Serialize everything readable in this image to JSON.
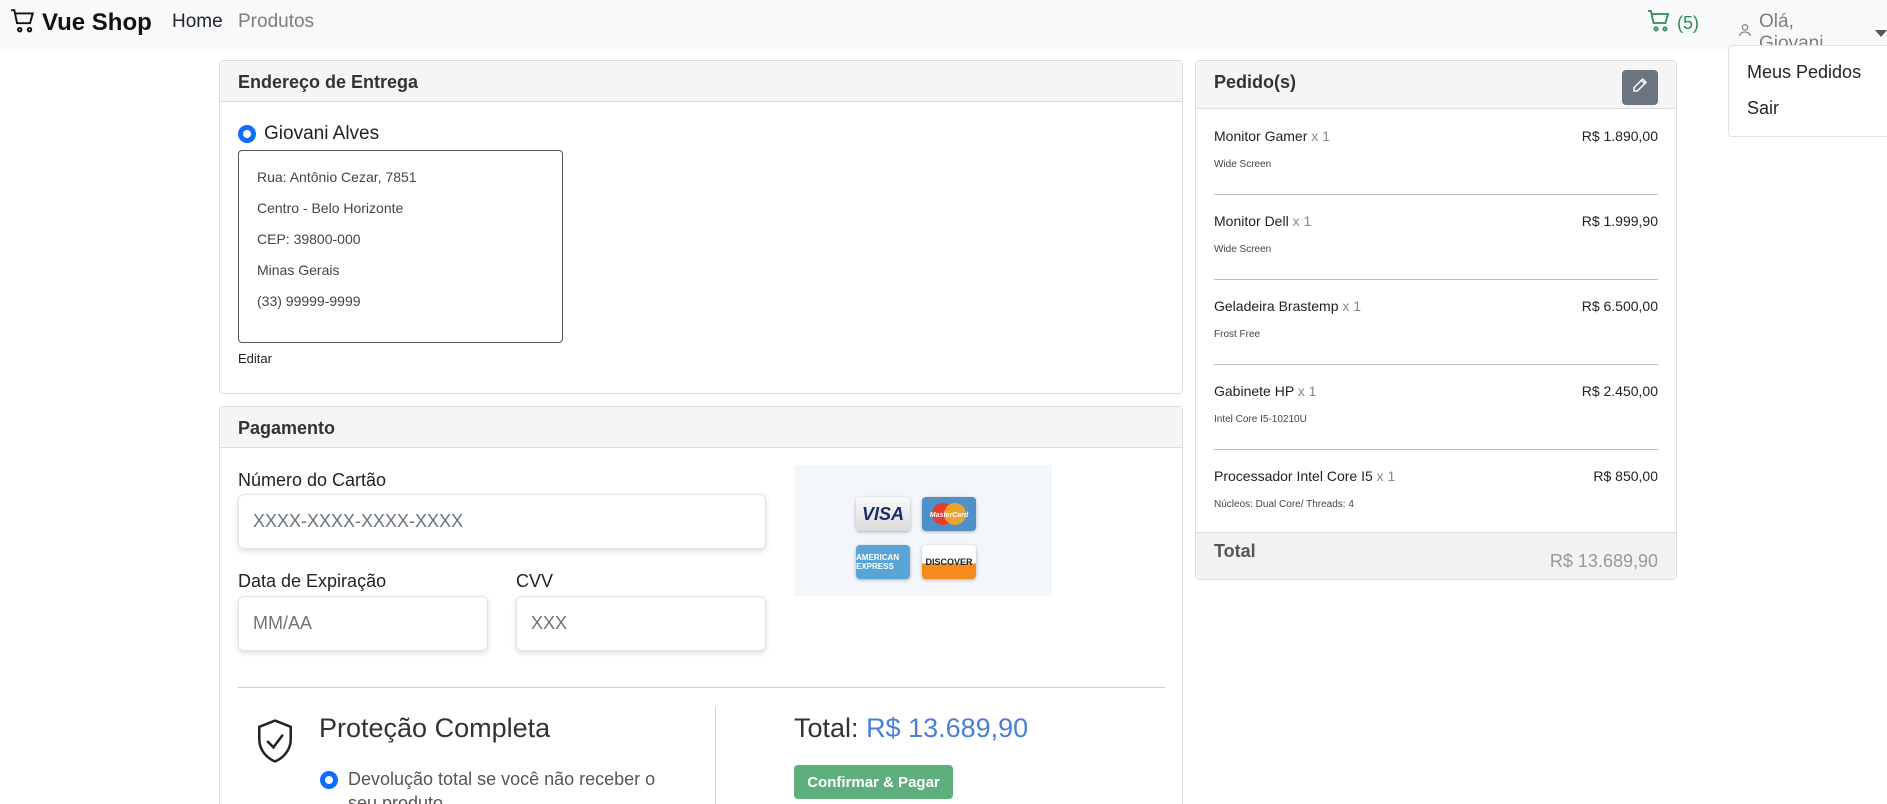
{
  "nav": {
    "brand": "Vue Shop",
    "links": [
      "Home",
      "Produtos"
    ],
    "cart_count": "(5)",
    "user_greeting": "Olá, Giovani",
    "dropdown": [
      "Meus Pedidos",
      "Sair"
    ]
  },
  "endereco": {
    "title": "Endereço de Entrega",
    "name": "Giovani Alves",
    "lines": [
      "Rua: Antônio Cezar, 7851",
      "Centro - Belo Horizonte",
      "CEP: 39800-000",
      "Minas Gerais",
      "(33) 99999-9999"
    ],
    "edit_label": "Editar"
  },
  "pagamento": {
    "title": "Pagamento",
    "card_number_label": "Número do Cartão",
    "card_number_placeholder": "XXXX-XXXX-XXXX-XXXX",
    "expiry_label": "Data de Expiração",
    "expiry_placeholder": "MM/AA",
    "cvv_label": "CVV",
    "cvv_placeholder": "XXX",
    "card_brands": [
      "VISA",
      "MasterCard",
      "AMERICAN EXPRESS",
      "DISCOVER"
    ],
    "protecao_title": "Proteção Completa",
    "devolucao_text": "Devolução total se você não receber o seu produto",
    "total_label": "Total:",
    "total_value": "R$ 13.689,90",
    "confirm_label": "Confirmar & Pagar"
  },
  "pedidos": {
    "title": "Pedido(s)",
    "items": [
      {
        "name": "Monitor Gamer",
        "qty": "x 1",
        "desc": "Wide Screen",
        "price": "R$ 1.890,00"
      },
      {
        "name": "Monitor Dell",
        "qty": "x 1",
        "desc": "Wide Screen",
        "price": "R$ 1.999,90"
      },
      {
        "name": "Geladeira Brastemp",
        "qty": "x 1",
        "desc": "Frost Free",
        "price": "R$ 6.500,00"
      },
      {
        "name": "Gabinete HP",
        "qty": "x 1",
        "desc": "Intel Core I5-10210U",
        "price": "R$ 2.450,00"
      },
      {
        "name": "Processador Intel Core I5",
        "qty": "x 1",
        "desc": "Núcleos: Dual Core/ Threads: 4",
        "price": "R$ 850,00"
      }
    ],
    "total_label": "Total",
    "total_value": "R$ 13.689,90"
  },
  "colors": {
    "primary": "#0d6efd",
    "success": "#5fae7e",
    "secondary": "#6c757d",
    "total_blue": "#4a7fd6"
  }
}
